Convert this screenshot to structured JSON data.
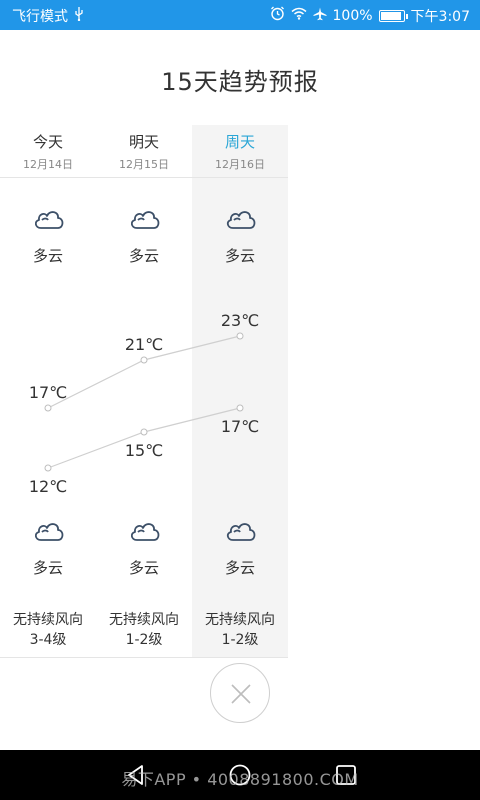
{
  "status_bar": {
    "airplane_mode": "飞行模式",
    "usb_icon": "usb-icon",
    "alarm_icon": "alarm-icon",
    "wifi_icon": "wifi-icon",
    "airplane_icon": "airplane-icon",
    "battery_percent": "100%",
    "battery_level": 1.0,
    "time": "下午3:07",
    "color": "#2196e8"
  },
  "title": "15天趋势预报",
  "days": [
    {
      "name": "今天",
      "date": "12月14日",
      "highlight": false,
      "day_weather": "多云",
      "night_weather": "多云",
      "high": "17℃",
      "low": "12℃",
      "wind_dir": "无持续风向",
      "wind_level": "3-4级"
    },
    {
      "name": "明天",
      "date": "12月15日",
      "highlight": false,
      "day_weather": "多云",
      "night_weather": "多云",
      "high": "21℃",
      "low": "15℃",
      "wind_dir": "无持续风向",
      "wind_level": "1-2级"
    },
    {
      "name": "周天",
      "date": "12月16日",
      "highlight": true,
      "day_weather": "多云",
      "night_weather": "多云",
      "high": "23℃",
      "low": "17℃",
      "wind_dir": "无持续风向",
      "wind_level": "1-2级"
    }
  ],
  "chart_data": {
    "type": "line",
    "categories": [
      "今天",
      "明天",
      "周天"
    ],
    "series": [
      {
        "values": [
          17,
          21,
          23
        ]
      },
      {
        "values": [
          12,
          15,
          17
        ]
      }
    ],
    "title": "",
    "xlabel": "",
    "ylabel": ""
  },
  "icons": {
    "cloud": "cloud-icon",
    "close": "close-icon",
    "back": "back-icon",
    "home": "home-icon",
    "recents": "recents-icon"
  },
  "accent_color": "#2aa6d6",
  "watermark": "易下APP • 4008891800.COM"
}
